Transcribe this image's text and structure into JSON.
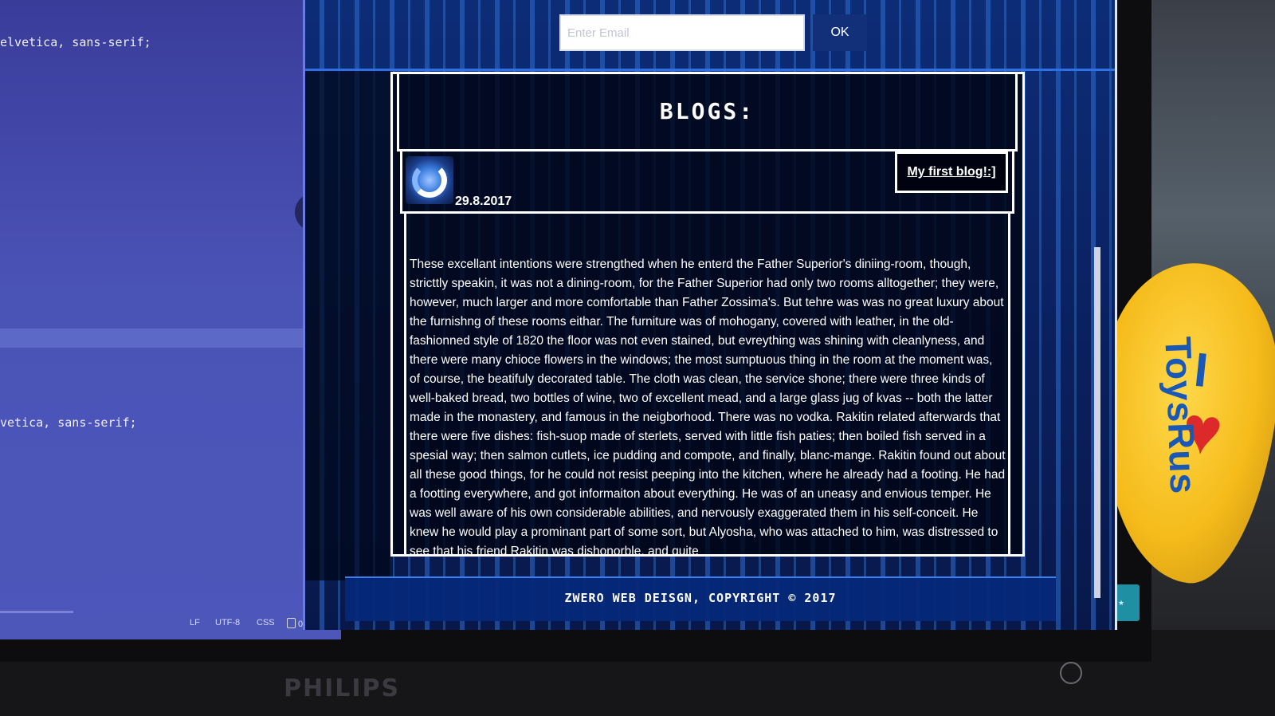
{
  "editor": {
    "code_lines": [
      "elvetica, sans-serif;",
      "vetica, sans-serif;"
    ],
    "collapse_icon": "chevron-left-icon",
    "status_bar": {
      "line_ending": "LF",
      "encoding": "UTF-8",
      "language": "CSS",
      "files": "0 files"
    }
  },
  "page": {
    "subscribe": {
      "email_placeholder": "Enter Email",
      "ok_label": "OK"
    },
    "blog": {
      "heading": "BLOGS:",
      "post": {
        "avatar_icon": "swirl-logo-icon",
        "date": "29.8.2017",
        "title": "My first blog!:]",
        "body": "These excellant intentions were strengthed when he enterd the Father Superior's diniing-room, though, stricttly speakin, it was not a dining-room, for the Father Superior had only two rooms alltogether; they were, however, much larger and more comfortable than Father Zossima's. But tehre was was no great luxury about the furnishng of these rooms eithar. The furniture was of mohogany, covered with leather, in the old-fashionned style of 1820 the floor was not even stained, but evreything was shining with cleanlyness, and there were many chioce flowers in the windows; the most sumptuous thing in the room at the moment was, of course, the beatifuly decorated table. The cloth was clean, the service shone; there were three kinds of well-baked bread, two bottles of wine, two of excellent mead, and a large glass jug of kvas -- both the latter made in the monastery, and famous in the neigborhood. There was no vodka. Rakitin related afterwards that there were five dishes: fish-suop made of sterlets, served with little fish paties; then boiled fish served in a spesial way; then salmon cutlets, ice pudding and compote, and finally, blanc-mange. Rakitin found out about all these good things, for he could not resist peeping into the kitchen, where he already had a footing. He had a footting everywhere, and got informaiton about everything. He was of an uneasy and envious temper. He was well aware of his own considerable abilities, and nervously exaggerated them in his self-conceit. He knew he would play a prominant part of some sort, but Alyosha, who was attached to him, was distressed to see that his friend Rakitin was dishonorble, and quite"
      }
    },
    "footer": "ZWERO WEB DEISGN, COPYRIGHT © 2017"
  },
  "surroundings": {
    "monitor_brand": "PHILIPS",
    "balloon_brand": "ToysRus",
    "balloon_letter": "I",
    "balloon_icon": "heart-icon",
    "power_icon": "power-button-icon"
  },
  "colors": {
    "page_background": "#0b2566",
    "accent_line": "#2f6fe6",
    "editor_background": "#4a53b6"
  }
}
